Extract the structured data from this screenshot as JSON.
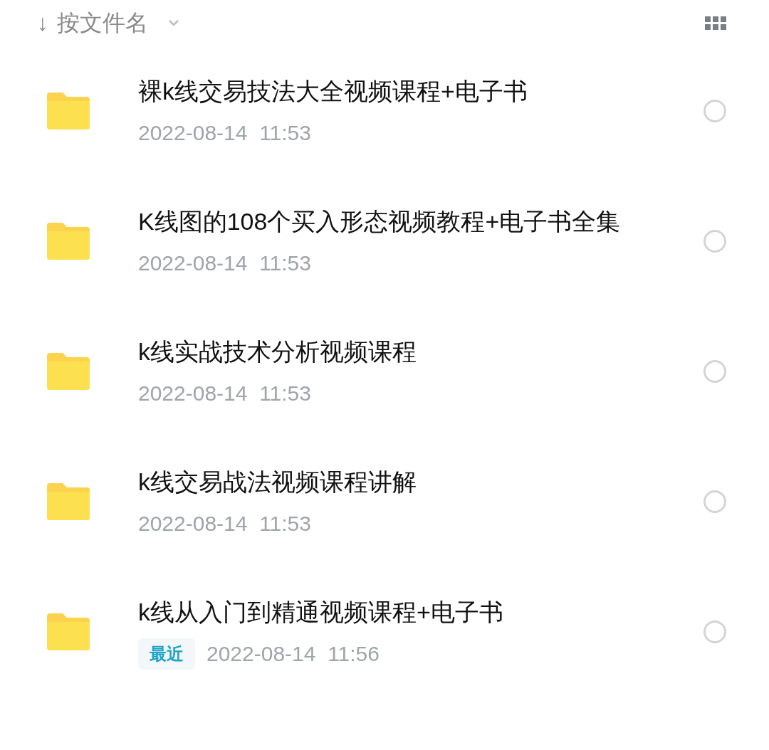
{
  "sort": {
    "arrow": "↓",
    "label": "按文件名"
  },
  "files": [
    {
      "name": "裸k线交易技法大全视频课程+电子书",
      "date": "2022-08-14  11:53",
      "selected": false
    },
    {
      "name": "K线图的108个买入形态视频教程+电子书全集",
      "date": "2022-08-14  11:53",
      "selected": false
    },
    {
      "name": "k线实战技术分析视频课程",
      "date": "2022-08-14  11:53",
      "selected": false
    },
    {
      "name": "k线交易战法视频课程讲解",
      "date": "2022-08-14  11:53",
      "selected": false
    },
    {
      "name": "k线从入门到精通视频课程+电子书",
      "tag": "最近",
      "date": "2022-08-14  11:56",
      "selected": false
    }
  ]
}
